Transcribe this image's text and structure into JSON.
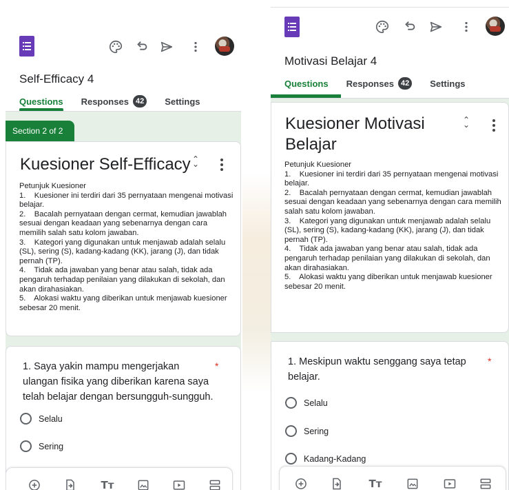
{
  "colors": {
    "accent": "#188038",
    "forms_purple": "#673ab7",
    "section_bg": "#e7f0e7",
    "required": "#d93025"
  },
  "left": {
    "form_title": "Self-Efficacy 4",
    "tabs": [
      {
        "label": "Questions",
        "active": true
      },
      {
        "label": "Responses",
        "badge": "42"
      },
      {
        "label": "Settings"
      }
    ],
    "section_label": "Section 2 of 2",
    "section_title": "Kuesioner Self-Efficacy",
    "description": "Petunjuk Kuesioner\n1.    Kuesioner ini terdiri dari 35 pernyataan mengenai motivasi belajar.\n2.    Bacalah pernyataan dengan cermat, kemudian jawablah sesuai dengan keadaan yang sebenarnya dengan cara memilih salah satu kolom jawaban.\n3.    Kategori yang digunakan untuk menjawab adalah selalu (SL), sering (S), kadang-kadang (KK), jarang (J), dan tidak pernah (TP).\n4.    Tidak ada jawaban yang benar atau salah, tidak ada pengaruh terhadap penilaian yang dilakukan di sekolah, dan akan dirahasiakan.\n5.    Alokasi waktu yang diberikan untuk menjawab kuesioner sebesar 20 menit.",
    "question": {
      "text": "1. Saya yakin mampu mengerjakan ulangan fisika yang diberikan karena saya telah belajar dengan bersungguh-sungguh.",
      "required_mark": "*",
      "options": [
        "Selalu",
        "Sering"
      ]
    }
  },
  "right": {
    "form_title": "Motivasi Belajar 4",
    "tabs": [
      {
        "label": "Questions",
        "active": true
      },
      {
        "label": "Responses",
        "badge": "42"
      },
      {
        "label": "Settings"
      }
    ],
    "section_title": "Kuesioner Motivasi Belajar",
    "description": "Petunjuk Kuesioner\n1.    Kuesioner ini terdiri dari 35 pernyataan mengenai motivasi belajar.\n2.    Bacalah pernyataan dengan cermat, kemudian jawablah sesuai dengan keadaan yang sebenarnya dengan cara memilih salah satu kolom jawaban.\n3.    Kategori yang digunakan untuk menjawab adalah selalu (SL), sering (S), kadang-kadang (KK), jarang (J), dan tidak pernah (TP).\n4.    Tidak ada jawaban yang benar atau salah, tidak ada pengaruh terhadap penilaian yang dilakukan di sekolah, dan akan dirahasiakan.\n5.    Alokasi waktu yang diberikan untuk menjawab kuesioner sebesar 20 menit.",
    "question": {
      "text": "1. Meskipun waktu senggang saya tetap belajar.",
      "required_mark": "*",
      "options": [
        "Selalu",
        "Sering",
        "Kadang-Kadang"
      ]
    }
  },
  "toolbar_icons": [
    "palette-icon",
    "undo-icon",
    "send-icon",
    "more-vert-icon"
  ],
  "bottom_bar_icons": [
    "add-question-icon",
    "import-questions-icon",
    "add-title-icon",
    "add-image-icon",
    "add-video-icon",
    "add-section-icon"
  ]
}
